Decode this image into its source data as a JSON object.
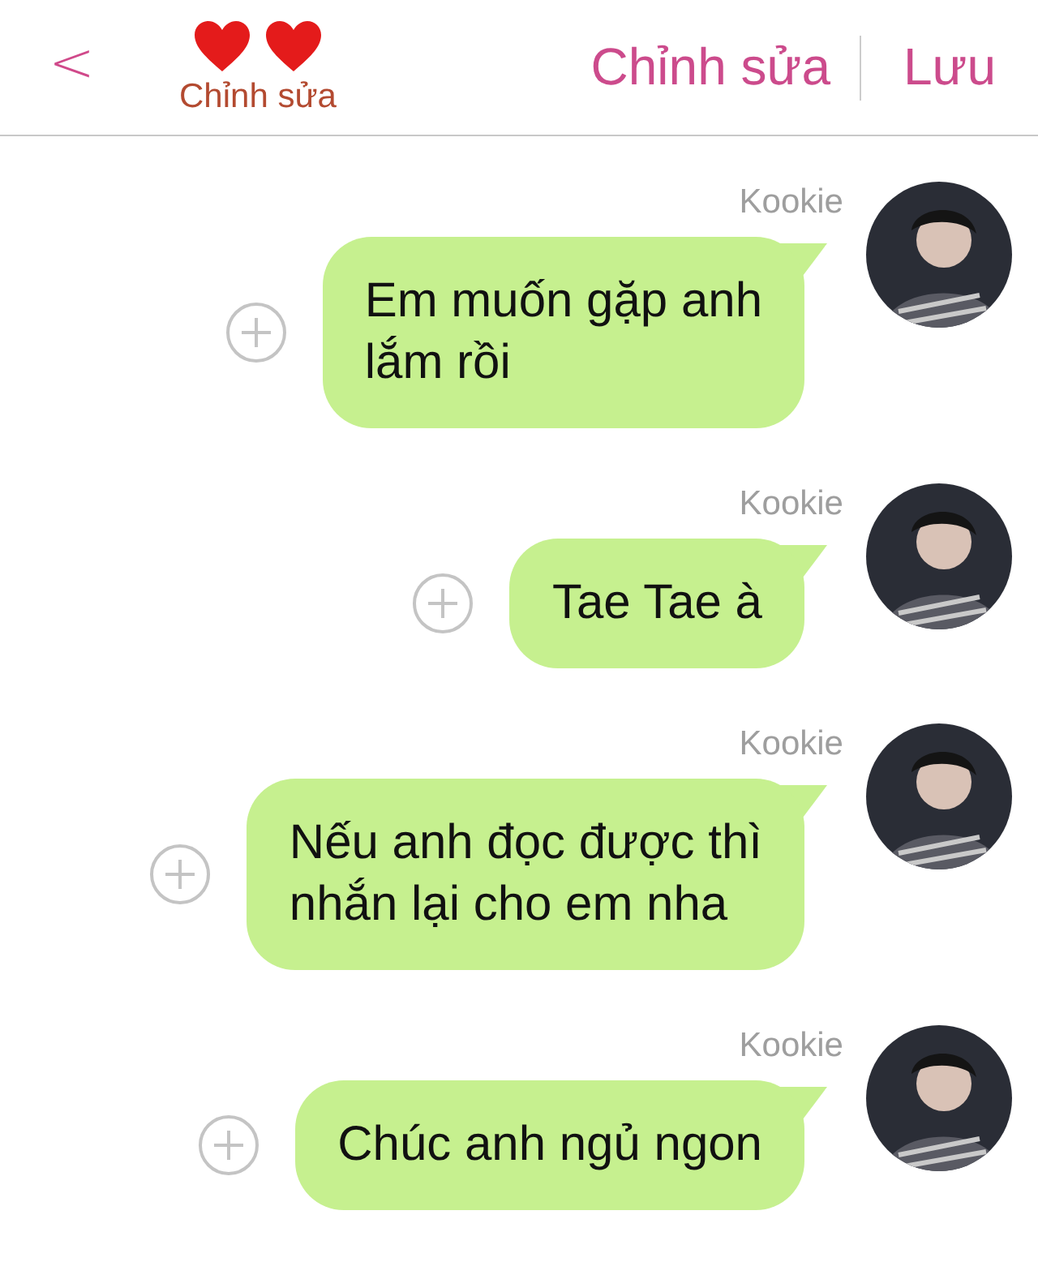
{
  "header": {
    "back": "<",
    "subtitle": "Chỉnh sửa",
    "actions": [
      "Chỉnh sửa",
      "Lưu"
    ]
  },
  "messages": [
    {
      "sender": "Kookie",
      "lines": [
        "Em muốn gặp anh",
        "lắm rồi"
      ]
    },
    {
      "sender": "Kookie",
      "lines": [
        "Tae Tae à"
      ]
    },
    {
      "sender": "Kookie",
      "lines": [
        "Nếu anh đọc được thì",
        "nhắn lại cho em nha"
      ]
    },
    {
      "sender": "Kookie",
      "lines": [
        "Chúc anh ngủ ngon"
      ]
    }
  ]
}
